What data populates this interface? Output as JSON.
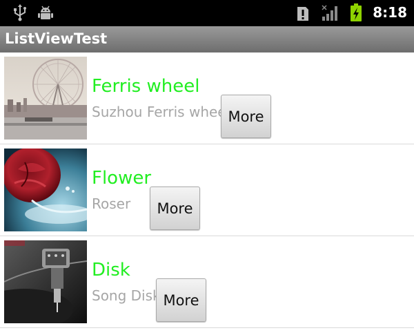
{
  "status_bar": {
    "time": "8:18",
    "icons": [
      "usb-icon",
      "android-debug-icon",
      "alert-icon",
      "signal-icon",
      "battery-charging-icon"
    ]
  },
  "app": {
    "title": "ListViewTest"
  },
  "list": {
    "items": [
      {
        "title": "Ferris wheel",
        "subtitle": "Suzhou Ferris wheel",
        "button": "More",
        "image": "ferris-wheel-photo"
      },
      {
        "title": "Flower",
        "subtitle": "Roser",
        "button": "More",
        "image": "rose-photo"
      },
      {
        "title": "Disk",
        "subtitle": "Song Disk",
        "button": "More",
        "image": "turntable-photo"
      }
    ]
  },
  "colors": {
    "title_green": "#22ee22",
    "subtitle_gray": "#a6a6a6",
    "battery_green": "#8ed300"
  }
}
